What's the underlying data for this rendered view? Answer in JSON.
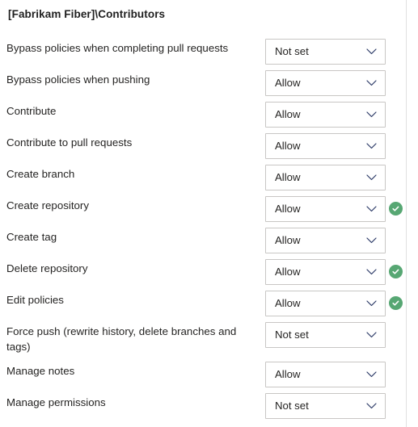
{
  "panel": {
    "group_title": "[Fabrikam Fiber]\\Contributors"
  },
  "colors": {
    "accent_green": "#57a773",
    "text": "#252423",
    "border": "#c8c6c4",
    "divider": "#e1e1e1",
    "background": "#ffffff"
  },
  "permissions": [
    {
      "label": "Bypass policies when completing pull requests",
      "value": "Not set",
      "inherited": false,
      "two_line": false
    },
    {
      "label": "Bypass policies when pushing",
      "value": "Allow",
      "inherited": false,
      "two_line": false
    },
    {
      "label": "Contribute",
      "value": "Allow",
      "inherited": false,
      "two_line": false
    },
    {
      "label": "Contribute to pull requests",
      "value": "Allow",
      "inherited": false,
      "two_line": false
    },
    {
      "label": "Create branch",
      "value": "Allow",
      "inherited": false,
      "two_line": false
    },
    {
      "label": "Create repository",
      "value": "Allow",
      "inherited": true,
      "two_line": false
    },
    {
      "label": "Create tag",
      "value": "Allow",
      "inherited": false,
      "two_line": false
    },
    {
      "label": "Delete repository",
      "value": "Allow",
      "inherited": true,
      "two_line": false
    },
    {
      "label": "Edit policies",
      "value": "Allow",
      "inherited": true,
      "two_line": false
    },
    {
      "label": "Force push (rewrite history, delete branches and tags)",
      "value": "Not set",
      "inherited": false,
      "two_line": true
    },
    {
      "label": "Manage notes",
      "value": "Allow",
      "inherited": false,
      "two_line": false
    },
    {
      "label": "Manage permissions",
      "value": "Not set",
      "inherited": false,
      "two_line": false
    }
  ],
  "icons": {
    "chevron": "chevron-down-icon",
    "inherited_check": "check-circle-icon"
  }
}
